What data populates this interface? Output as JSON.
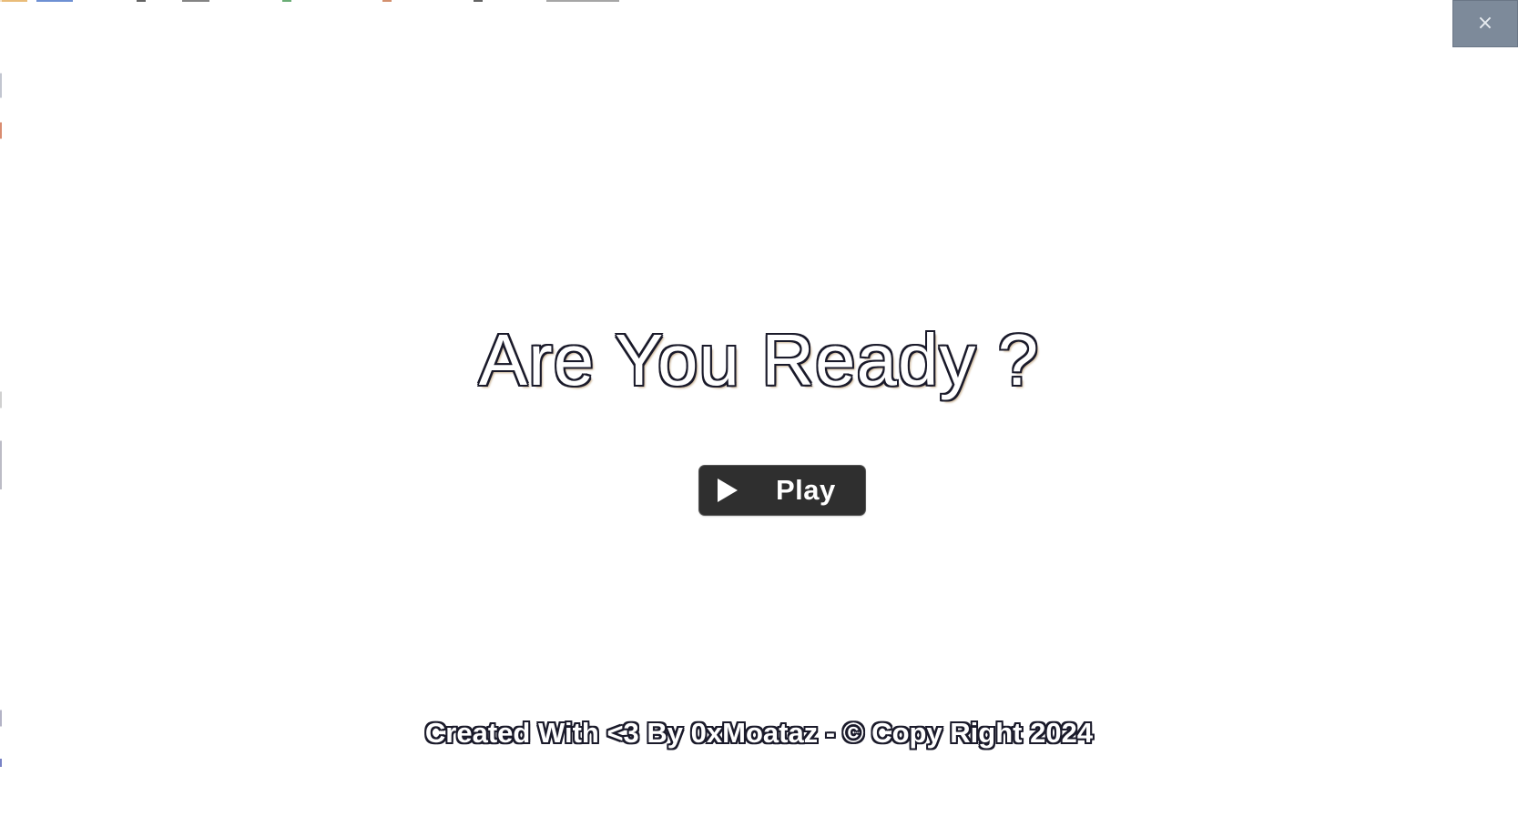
{
  "window": {
    "close_icon": "close-icon",
    "close_glyph": "×"
  },
  "game": {
    "title": "Are You Ready ?",
    "play_button": {
      "icon": "play-icon",
      "label": "Play"
    }
  },
  "footer": {
    "credit": "Created With <3 By 0xMoataz - © Copy Right 2024"
  },
  "colors": {
    "background": "#ffffff",
    "play_button_bg": "#2f2f2f",
    "close_button_bg": "#7d8a9a",
    "text_outline": "#1a1a2a"
  }
}
